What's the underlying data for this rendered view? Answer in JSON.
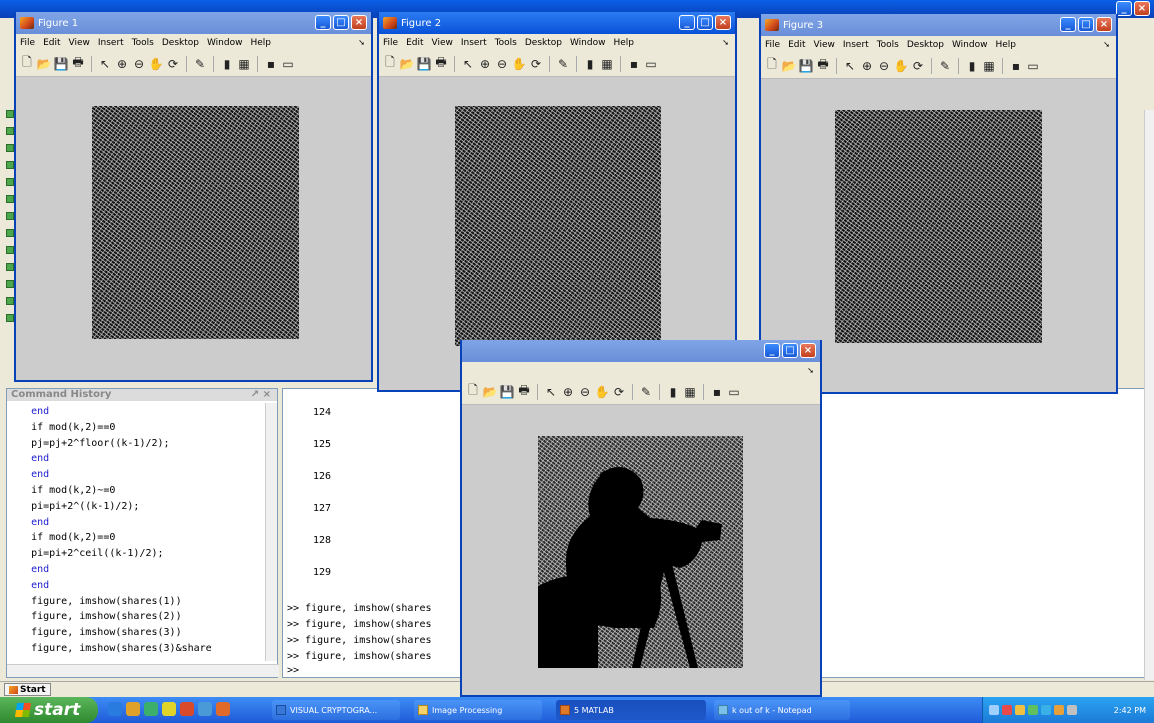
{
  "figures": [
    {
      "title": "Figure 1",
      "menu": [
        "File",
        "Edit",
        "View",
        "Insert",
        "Tools",
        "Desktop",
        "Window",
        "Help"
      ]
    },
    {
      "title": "Figure 2",
      "menu": [
        "File",
        "Edit",
        "View",
        "Insert",
        "Tools",
        "Desktop",
        "Window",
        "Help"
      ]
    },
    {
      "title": "Figure 3",
      "menu": [
        "File",
        "Edit",
        "View",
        "Insert",
        "Tools",
        "Desktop",
        "Window",
        "Help"
      ]
    }
  ],
  "command_history": {
    "title": "Command History",
    "lines": [
      {
        "text": "    end",
        "kw": true
      },
      {
        "text": "    if mod(k,2)==0",
        "kw": false
      },
      {
        "text": "    pj=pj+2^floor((k-1)/2);",
        "kw": false
      },
      {
        "text": "    end",
        "kw": true
      },
      {
        "text": "    end",
        "kw": true
      },
      {
        "text": "    if mod(k,2)~=0",
        "kw": false
      },
      {
        "text": "    pi=pi+2^((k-1)/2);",
        "kw": false
      },
      {
        "text": "    end",
        "kw": true
      },
      {
        "text": "    if mod(k,2)==0",
        "kw": false
      },
      {
        "text": "    pi=pi+2^ceil((k-1)/2);",
        "kw": false
      },
      {
        "text": "    end",
        "kw": true
      },
      {
        "text": "    end",
        "kw": true
      },
      {
        "text": "    figure, imshow(shares(1))",
        "kw": false
      },
      {
        "text": "    figure, imshow(shares(2))",
        "kw": false
      },
      {
        "text": "    figure, imshow(shares(3))",
        "kw": false
      },
      {
        "text": "    figure, imshow(shares(3)&share",
        "kw": false
      }
    ]
  },
  "command_window": {
    "line_numbers": [
      "124",
      "125",
      "126",
      "127",
      "128",
      "129"
    ],
    "prompts": [
      ">> figure, imshow(shares",
      ">> figure, imshow(shares",
      ">> figure, imshow(shares",
      ">> figure, imshow(shares",
      ">>"
    ]
  },
  "matlab_start": "Start",
  "taskbar": {
    "start_label": "start",
    "tasks": [
      {
        "label": "VISUAL CRYPTOGRA...",
        "active": false
      },
      {
        "label": "Image Processing",
        "active": false
      },
      {
        "label": "5 MATLAB",
        "active": true
      },
      {
        "label": "k out of k - Notepad",
        "active": false
      }
    ],
    "clock": "2:42 PM"
  }
}
